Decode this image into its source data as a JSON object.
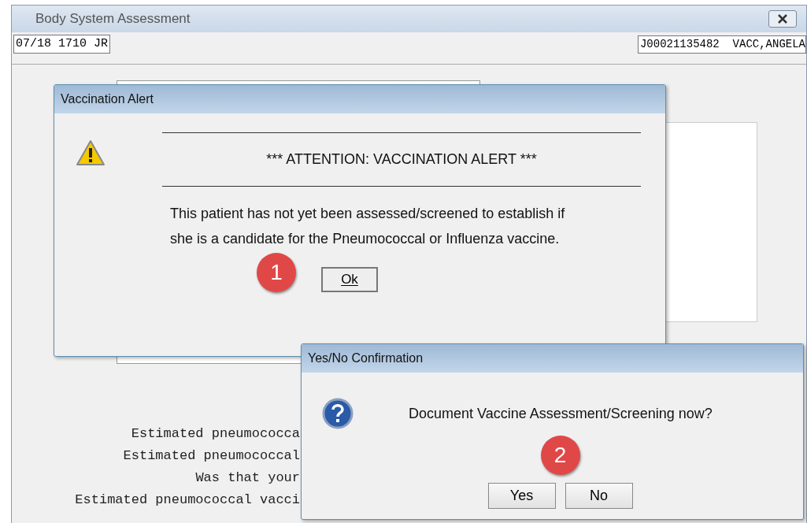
{
  "window": {
    "title": "Body System Assessment",
    "fields": [
      "07/18 1710  JR",
      "J00021135482  VACC,ANGELA"
    ],
    "lines": [
      "Estimated pneumococca",
      "Estimated pneumococcal",
      "Was that your",
      "Estimated pneumococcal vacci"
    ]
  },
  "alert": {
    "title": "Vaccination Alert",
    "heading": "*** ATTENTION: VACCINATION ALERT ***",
    "message": "This patient has not yet been assessed/screened to establish if she is a candidate for the Pneumococcal or Influenza vaccine.",
    "button": "Ok",
    "marker": "1"
  },
  "confirm": {
    "title": "Yes/No Confirmation",
    "message": "Document Vaccine Assessment/Screening now?",
    "marker": "2",
    "buttons": [
      "Yes",
      "No"
    ]
  }
}
